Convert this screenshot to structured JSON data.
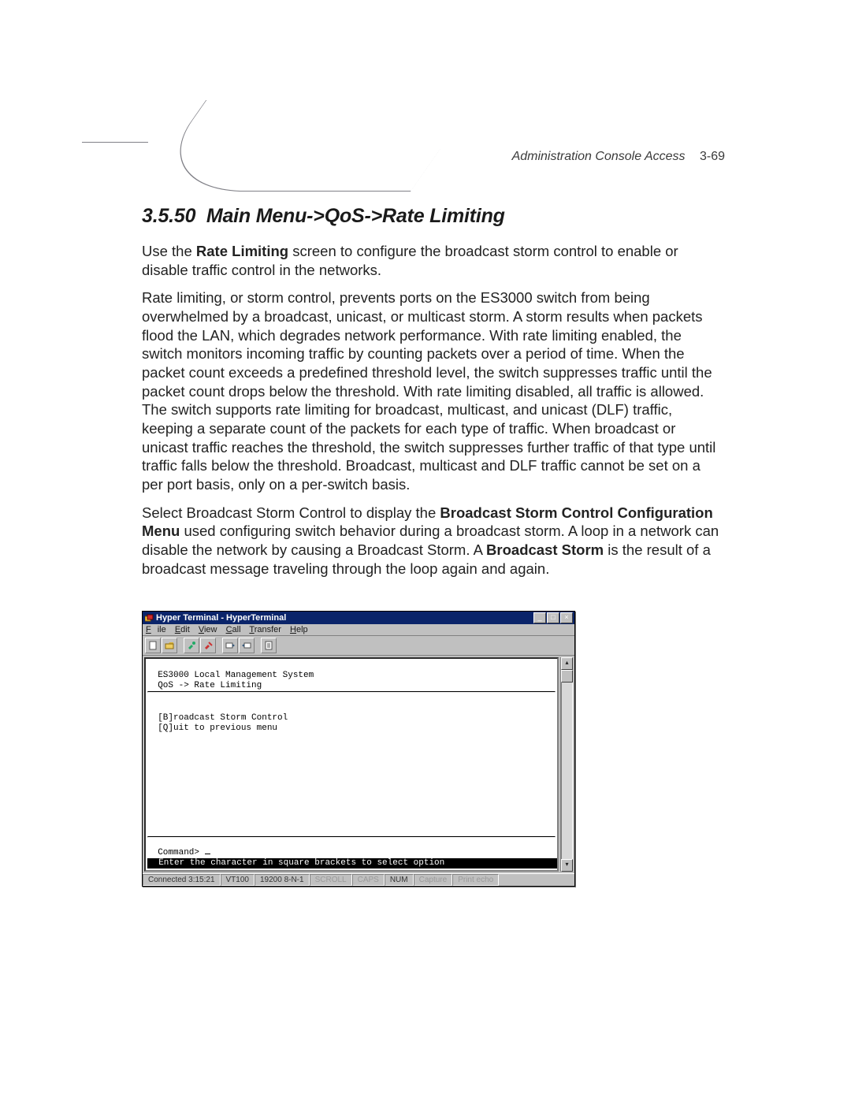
{
  "header": {
    "running": "Administration Console Access",
    "page": "3-69"
  },
  "section": {
    "number": "3.5.50",
    "title": "Main Menu->QoS->Rate Limiting"
  },
  "p1": {
    "pre": "Use the ",
    "b1": "Rate Limiting",
    "post": " screen to configure the broadcast storm control to enable or disable traffic control in the networks."
  },
  "p2": "Rate limiting, or storm control, prevents ports on the ES3000 switch from being overwhelmed by a broadcast, unicast, or multicast storm. A storm results when packets flood the LAN, which degrades network performance. With rate limiting enabled, the switch monitors incoming traffic by counting packets over a period of time. When the packet count exceeds a predefined threshold level, the switch suppresses traffic until the packet count drops below the threshold. With rate limiting disabled, all traffic is allowed. The switch supports rate limiting for broadcast, multicast, and unicast (DLF) traffic, keeping a separate count of the packets for each type of traffic. When broadcast or unicast traffic reaches the threshold, the switch suppresses further traffic of that type until traffic falls below the threshold. Broadcast, multicast and DLF traffic cannot be set on a per port basis, only on a per-switch basis.",
  "p3": {
    "s1": "Select Broadcast Storm Control to display the ",
    "b1": "Broadcast Storm Control Configuration Menu",
    "s2": " used configuring switch behavior during a broadcast storm. A loop in a network can disable the network by causing a Broadcast Storm. A ",
    "b2": "Broadcast Storm",
    "s3": " is the result of a broadcast message traveling through the loop again and again."
  },
  "ht": {
    "title": "Hyper Terminal - HyperTerminal",
    "menu": {
      "file": "File",
      "edit": "Edit",
      "view": "View",
      "call": "Call",
      "transfer": "Transfer",
      "help": "Help"
    },
    "term": {
      "l1": "ES3000 Local Management System",
      "l2": "QoS -> Rate Limiting",
      "opt1": "[B]roadcast Storm Control",
      "opt2": "[Q]uit to previous menu",
      "prompt": "Command> ",
      "hint": "Enter the character in square brackets to select option"
    },
    "status": {
      "conn": "Connected 3:15:21",
      "emul": "VT100",
      "baud": "19200 8-N-1",
      "scroll": "SCROLL",
      "caps": "CAPS",
      "num": "NUM",
      "capture": "Capture",
      "echo": "Print echo"
    }
  }
}
